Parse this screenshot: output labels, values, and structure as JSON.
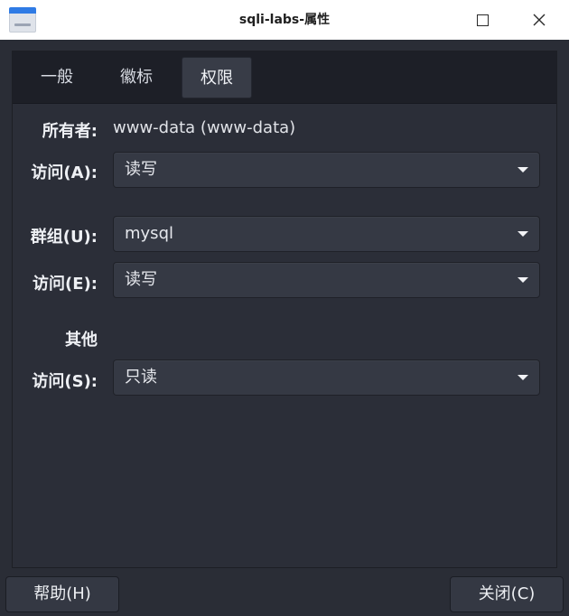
{
  "window": {
    "title": "sqli-labs-属性",
    "icon": "folder-app-icon",
    "controls": [
      "maximize-icon",
      "close-icon"
    ]
  },
  "tabs": [
    {
      "label": "一般",
      "active": false
    },
    {
      "label": "徽标",
      "active": false
    },
    {
      "label": "权限",
      "active": true
    }
  ],
  "owner": {
    "label": "所有者:",
    "value": "www-data (www-data)",
    "access_label": "访问(A):",
    "access_value": "读写"
  },
  "group": {
    "label": "群组(U):",
    "value": "mysql",
    "access_label": "访问(E):",
    "access_value": "读写"
  },
  "other": {
    "label": "其他",
    "access_label": "访问(S):",
    "access_value": "只读"
  },
  "buttons": {
    "help": "帮助(H)",
    "close": "关闭(C)"
  }
}
